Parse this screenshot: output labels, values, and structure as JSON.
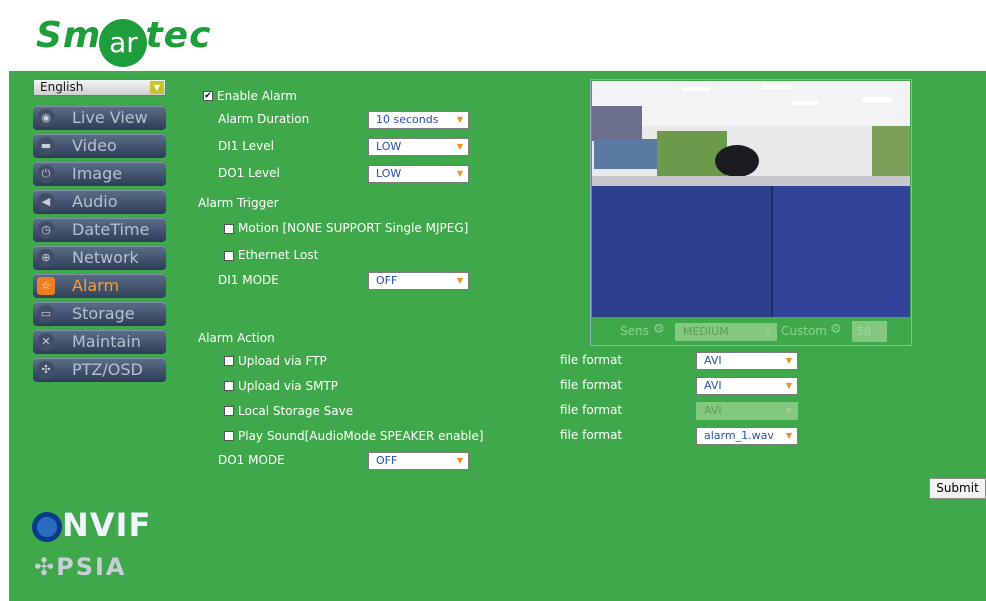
{
  "brand": {
    "name_left": "Sm",
    "name_mid": "ar",
    "name_right": "tec"
  },
  "language": {
    "selected": "English"
  },
  "nav": [
    {
      "label": "Live View",
      "icon": "speech-icon"
    },
    {
      "label": "Video",
      "icon": "camera-icon"
    },
    {
      "label": "Image",
      "icon": "power-icon"
    },
    {
      "label": "Audio",
      "icon": "speaker-icon"
    },
    {
      "label": "DateTime",
      "icon": "clock-icon"
    },
    {
      "label": "Network",
      "icon": "globe-icon"
    },
    {
      "label": "Alarm",
      "icon": "star-icon",
      "active": true
    },
    {
      "label": "Storage",
      "icon": "drive-icon"
    },
    {
      "label": "Maintain",
      "icon": "tools-icon"
    },
    {
      "label": "PTZ/OSD",
      "icon": "ptz-icon"
    }
  ],
  "alarm": {
    "enable_label": "Enable Alarm",
    "duration_label": "Alarm Duration",
    "duration_value": "10 seconds",
    "di1_level_label": "DI1 Level",
    "di1_level_value": "LOW",
    "do1_level_label": "DO1 Level",
    "do1_level_value": "LOW"
  },
  "trigger": {
    "heading": "Alarm Trigger",
    "motion_label": "Motion [NONE SUPPORT Single MJPEG]",
    "ethernet_label": "Ethernet Lost",
    "di1_mode_label": "DI1 MODE",
    "di1_mode_value": "OFF"
  },
  "video": {
    "sens_label": "Sens",
    "sens_value": "MEDIUM",
    "custom_label": "Custom",
    "custom_value": "50"
  },
  "action": {
    "heading": "Alarm Action",
    "ftp_label": "Upload via FTP",
    "smtp_label": "Upload via SMTP",
    "local_label": "Local Storage Save",
    "sound_label": "Play Sound[AudioMode SPEAKER enable]",
    "do1_mode_label": "DO1 MODE",
    "do1_mode_value": "OFF",
    "file_format_label": "file format",
    "ftp_format": "AVI",
    "smtp_format": "AVI",
    "local_format": "AVI",
    "sound_format": "alarm_1.wav"
  },
  "submit_label": "Submit",
  "logos": {
    "onvif": "NVIF",
    "psia": "PSIA"
  },
  "colors": {
    "panel": "#3fa84a",
    "brand": "#1e9e3a",
    "nav_active": "#ff9b2c",
    "select_text": "#2451b0"
  }
}
